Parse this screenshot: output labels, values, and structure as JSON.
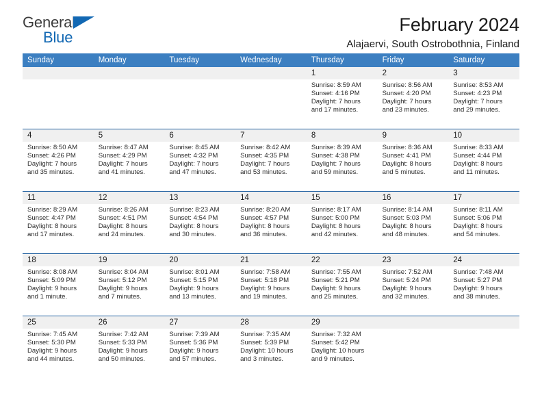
{
  "brand": {
    "word1": "General",
    "word2": "Blue",
    "triangle_color": "#1268b3",
    "text_color": "#3c3c3c"
  },
  "header": {
    "title": "February 2024",
    "subtitle": "Alajaervi, South Ostrobothnia, Finland"
  },
  "theme": {
    "header_bar": "#3c7fc1",
    "row_divider": "#1f5fa0",
    "date_band": "#f0f0f0",
    "text": "#1a1a1a"
  },
  "calendar": {
    "weekdays": [
      "Sunday",
      "Monday",
      "Tuesday",
      "Wednesday",
      "Thursday",
      "Friday",
      "Saturday"
    ],
    "weeks": [
      [
        {
          "day": "",
          "empty": true
        },
        {
          "day": "",
          "empty": true
        },
        {
          "day": "",
          "empty": true
        },
        {
          "day": "",
          "empty": true
        },
        {
          "day": "1",
          "sunrise": "Sunrise: 8:59 AM",
          "sunset": "Sunset: 4:16 PM",
          "daylight1": "Daylight: 7 hours",
          "daylight2": "and 17 minutes."
        },
        {
          "day": "2",
          "sunrise": "Sunrise: 8:56 AM",
          "sunset": "Sunset: 4:20 PM",
          "daylight1": "Daylight: 7 hours",
          "daylight2": "and 23 minutes."
        },
        {
          "day": "3",
          "sunrise": "Sunrise: 8:53 AM",
          "sunset": "Sunset: 4:23 PM",
          "daylight1": "Daylight: 7 hours",
          "daylight2": "and 29 minutes."
        }
      ],
      [
        {
          "day": "4",
          "sunrise": "Sunrise: 8:50 AM",
          "sunset": "Sunset: 4:26 PM",
          "daylight1": "Daylight: 7 hours",
          "daylight2": "and 35 minutes."
        },
        {
          "day": "5",
          "sunrise": "Sunrise: 8:47 AM",
          "sunset": "Sunset: 4:29 PM",
          "daylight1": "Daylight: 7 hours",
          "daylight2": "and 41 minutes."
        },
        {
          "day": "6",
          "sunrise": "Sunrise: 8:45 AM",
          "sunset": "Sunset: 4:32 PM",
          "daylight1": "Daylight: 7 hours",
          "daylight2": "and 47 minutes."
        },
        {
          "day": "7",
          "sunrise": "Sunrise: 8:42 AM",
          "sunset": "Sunset: 4:35 PM",
          "daylight1": "Daylight: 7 hours",
          "daylight2": "and 53 minutes."
        },
        {
          "day": "8",
          "sunrise": "Sunrise: 8:39 AM",
          "sunset": "Sunset: 4:38 PM",
          "daylight1": "Daylight: 7 hours",
          "daylight2": "and 59 minutes."
        },
        {
          "day": "9",
          "sunrise": "Sunrise: 8:36 AM",
          "sunset": "Sunset: 4:41 PM",
          "daylight1": "Daylight: 8 hours",
          "daylight2": "and 5 minutes."
        },
        {
          "day": "10",
          "sunrise": "Sunrise: 8:33 AM",
          "sunset": "Sunset: 4:44 PM",
          "daylight1": "Daylight: 8 hours",
          "daylight2": "and 11 minutes."
        }
      ],
      [
        {
          "day": "11",
          "sunrise": "Sunrise: 8:29 AM",
          "sunset": "Sunset: 4:47 PM",
          "daylight1": "Daylight: 8 hours",
          "daylight2": "and 17 minutes."
        },
        {
          "day": "12",
          "sunrise": "Sunrise: 8:26 AM",
          "sunset": "Sunset: 4:51 PM",
          "daylight1": "Daylight: 8 hours",
          "daylight2": "and 24 minutes."
        },
        {
          "day": "13",
          "sunrise": "Sunrise: 8:23 AM",
          "sunset": "Sunset: 4:54 PM",
          "daylight1": "Daylight: 8 hours",
          "daylight2": "and 30 minutes."
        },
        {
          "day": "14",
          "sunrise": "Sunrise: 8:20 AM",
          "sunset": "Sunset: 4:57 PM",
          "daylight1": "Daylight: 8 hours",
          "daylight2": "and 36 minutes."
        },
        {
          "day": "15",
          "sunrise": "Sunrise: 8:17 AM",
          "sunset": "Sunset: 5:00 PM",
          "daylight1": "Daylight: 8 hours",
          "daylight2": "and 42 minutes."
        },
        {
          "day": "16",
          "sunrise": "Sunrise: 8:14 AM",
          "sunset": "Sunset: 5:03 PM",
          "daylight1": "Daylight: 8 hours",
          "daylight2": "and 48 minutes."
        },
        {
          "day": "17",
          "sunrise": "Sunrise: 8:11 AM",
          "sunset": "Sunset: 5:06 PM",
          "daylight1": "Daylight: 8 hours",
          "daylight2": "and 54 minutes."
        }
      ],
      [
        {
          "day": "18",
          "sunrise": "Sunrise: 8:08 AM",
          "sunset": "Sunset: 5:09 PM",
          "daylight1": "Daylight: 9 hours",
          "daylight2": "and 1 minute."
        },
        {
          "day": "19",
          "sunrise": "Sunrise: 8:04 AM",
          "sunset": "Sunset: 5:12 PM",
          "daylight1": "Daylight: 9 hours",
          "daylight2": "and 7 minutes."
        },
        {
          "day": "20",
          "sunrise": "Sunrise: 8:01 AM",
          "sunset": "Sunset: 5:15 PM",
          "daylight1": "Daylight: 9 hours",
          "daylight2": "and 13 minutes."
        },
        {
          "day": "21",
          "sunrise": "Sunrise: 7:58 AM",
          "sunset": "Sunset: 5:18 PM",
          "daylight1": "Daylight: 9 hours",
          "daylight2": "and 19 minutes."
        },
        {
          "day": "22",
          "sunrise": "Sunrise: 7:55 AM",
          "sunset": "Sunset: 5:21 PM",
          "daylight1": "Daylight: 9 hours",
          "daylight2": "and 25 minutes."
        },
        {
          "day": "23",
          "sunrise": "Sunrise: 7:52 AM",
          "sunset": "Sunset: 5:24 PM",
          "daylight1": "Daylight: 9 hours",
          "daylight2": "and 32 minutes."
        },
        {
          "day": "24",
          "sunrise": "Sunrise: 7:48 AM",
          "sunset": "Sunset: 5:27 PM",
          "daylight1": "Daylight: 9 hours",
          "daylight2": "and 38 minutes."
        }
      ],
      [
        {
          "day": "25",
          "sunrise": "Sunrise: 7:45 AM",
          "sunset": "Sunset: 5:30 PM",
          "daylight1": "Daylight: 9 hours",
          "daylight2": "and 44 minutes."
        },
        {
          "day": "26",
          "sunrise": "Sunrise: 7:42 AM",
          "sunset": "Sunset: 5:33 PM",
          "daylight1": "Daylight: 9 hours",
          "daylight2": "and 50 minutes."
        },
        {
          "day": "27",
          "sunrise": "Sunrise: 7:39 AM",
          "sunset": "Sunset: 5:36 PM",
          "daylight1": "Daylight: 9 hours",
          "daylight2": "and 57 minutes."
        },
        {
          "day": "28",
          "sunrise": "Sunrise: 7:35 AM",
          "sunset": "Sunset: 5:39 PM",
          "daylight1": "Daylight: 10 hours",
          "daylight2": "and 3 minutes."
        },
        {
          "day": "29",
          "sunrise": "Sunrise: 7:32 AM",
          "sunset": "Sunset: 5:42 PM",
          "daylight1": "Daylight: 10 hours",
          "daylight2": "and 9 minutes."
        },
        {
          "day": "",
          "empty": true
        },
        {
          "day": "",
          "empty": true
        }
      ]
    ]
  }
}
